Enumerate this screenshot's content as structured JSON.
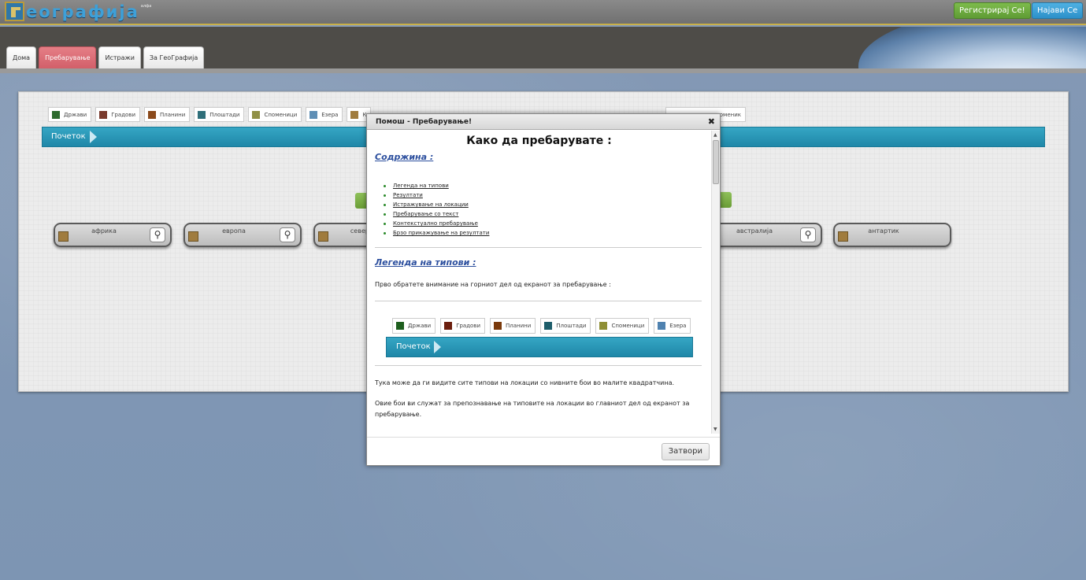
{
  "app": {
    "logo_text": "еографија",
    "logo_sup": "алфа",
    "register_label": "Регистрирај Се!",
    "login_label": "Најави Се"
  },
  "tabs": [
    {
      "label": "Дома"
    },
    {
      "label": "Пребарување"
    },
    {
      "label": "Истражи"
    },
    {
      "label": "За ГеоГрафија"
    }
  ],
  "legend": [
    {
      "label": "Држави",
      "color": "#2e6b2e"
    },
    {
      "label": "Градови",
      "color": "#7a3b2e"
    },
    {
      "label": "Планини",
      "color": "#8b4a1c"
    },
    {
      "label": "Плоштади",
      "color": "#2f6f7a"
    },
    {
      "label": "Споменици",
      "color": "#8f8f45"
    },
    {
      "label": "Езера",
      "color": "#5f8fb5"
    },
    {
      "label": "К",
      "color": "#a07c3e"
    }
  ],
  "legend_tail": "оменик",
  "breadcrumb": {
    "label": "Почеток"
  },
  "continents": [
    {
      "name": "африка"
    },
    {
      "name": "европа"
    },
    {
      "name": "северна"
    },
    {
      "name": "австралија"
    },
    {
      "name": "антартик"
    }
  ],
  "modal": {
    "title": "Помош - Пребарување!",
    "close_x": "✖",
    "heading": "Како да пребарувате :",
    "contents_heading": "Содржина :",
    "toc": [
      "Легенда на типови",
      "Резултати",
      "Истражување на локации",
      "Пребарување со текст",
      "Контекстуално пребарување",
      "Брзо прикажување на резултати"
    ],
    "legend_heading": "Легенда на типови :",
    "p1": "Прво обратете внимание на горниот дел од екранот за пребарување :",
    "shot_legend": [
      {
        "label": "Држави",
        "color": "#1e5e1e"
      },
      {
        "label": "Градови",
        "color": "#6b1e0e"
      },
      {
        "label": "Планини",
        "color": "#7a3a0c"
      },
      {
        "label": "Плоштади",
        "color": "#1e5e6b"
      },
      {
        "label": "Споменици",
        "color": "#8f8f35"
      },
      {
        "label": "Езера",
        "color": "#4f82b0"
      }
    ],
    "shot_breadcrumb": "Почеток",
    "p2": "Тука може да ги видите сите типови на локации со нивните бои во малите квадратчина.",
    "p3": "Овие бои ви служат за препознавање на типовите на локации во главниот дел од екранот за пребарување.",
    "close_label": "Затвори"
  }
}
